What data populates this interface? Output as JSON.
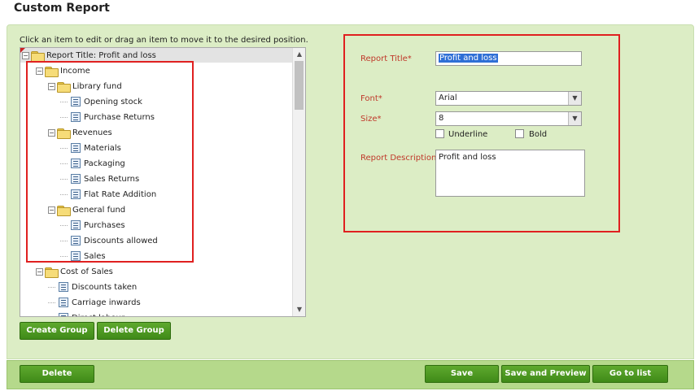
{
  "page": {
    "title": "Custom Report"
  },
  "tree": {
    "instructions": "Click an item to edit or drag an item to move it to the desired position.",
    "root_label": "Report Title: Profit and loss",
    "nodes": [
      {
        "label": "Income",
        "type": "folder",
        "level": 1
      },
      {
        "label": "Library fund",
        "type": "folder",
        "level": 2
      },
      {
        "label": "Opening stock",
        "type": "item",
        "level": 3
      },
      {
        "label": "Purchase Returns",
        "type": "item",
        "level": 3
      },
      {
        "label": "Revenues",
        "type": "folder",
        "level": 2
      },
      {
        "label": "Materials",
        "type": "item",
        "level": 3
      },
      {
        "label": "Packaging",
        "type": "item",
        "level": 3
      },
      {
        "label": "Sales Returns",
        "type": "item",
        "level": 3
      },
      {
        "label": "Flat Rate Addition",
        "type": "item",
        "level": 3
      },
      {
        "label": "General fund",
        "type": "folder",
        "level": 2
      },
      {
        "label": "Purchases",
        "type": "item",
        "level": 3
      },
      {
        "label": "Discounts allowed",
        "type": "item",
        "level": 3
      },
      {
        "label": "Sales",
        "type": "item",
        "level": 3
      },
      {
        "label": "Cost of Sales",
        "type": "folder",
        "level": 1
      },
      {
        "label": "Discounts taken",
        "type": "item",
        "level": 2
      },
      {
        "label": "Carriage inwards",
        "type": "item",
        "level": 2
      },
      {
        "label": "Direct labour",
        "type": "item",
        "level": 2
      }
    ]
  },
  "buttons": {
    "create_group": "Create Group",
    "delete_group": "Delete Group",
    "delete": "Delete",
    "save": "Save",
    "save_and_preview": "Save and Preview",
    "go_to_list": "Go to list"
  },
  "form": {
    "report_title_label": "Report Title*",
    "report_title_value": "Profit and loss",
    "font_label": "Font*",
    "font_value": "Arial",
    "size_label": "Size*",
    "size_value": "8",
    "underline_label": "Underline",
    "bold_label": "Bold",
    "description_label": "Report Description*",
    "description_value": "Profit and loss"
  },
  "icons": {
    "folder": "folder-icon",
    "item": "report-item-icon",
    "toggle": "collapse-toggle-icon",
    "dropdown": "chevron-down-icon"
  },
  "colors": {
    "panel_bg": "#dcedc5",
    "footer_bg": "#b5d98b",
    "button_green": "#4a9a22",
    "highlight_red": "#e02020",
    "label_red": "#c0392b"
  }
}
